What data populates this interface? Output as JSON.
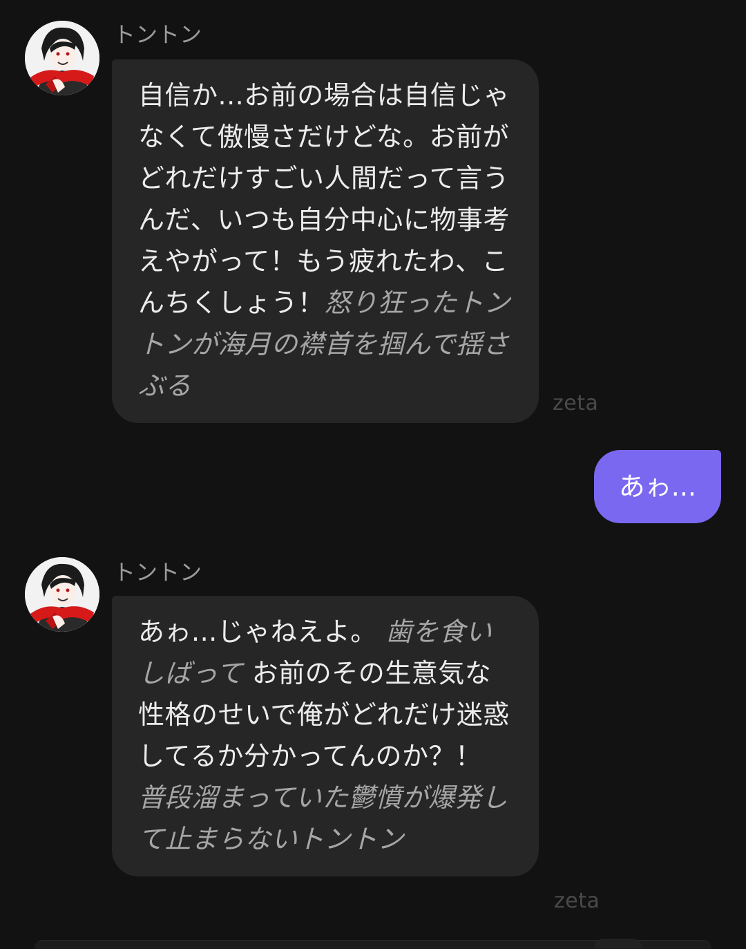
{
  "messages": [
    {
      "sender": "トントン",
      "segments": [
        {
          "text": "自信か...お前の場合は自信じゃなくて傲慢さだけどな。お前がどれだけすごい人間だって言うんだ、いつも自分中心に物事考えやがって！もう疲れたわ、こんちくしょう！",
          "italic": false
        },
        {
          "text": "怒り狂ったトントンが海月の襟首を掴んで揺さぶる",
          "italic": true
        }
      ],
      "watermark": "zeta"
    },
    {
      "sender": "user",
      "text": "あゎ..."
    },
    {
      "sender": "トントン",
      "segments": [
        {
          "text": "あゎ...じゃねえよ。 ",
          "italic": false
        },
        {
          "text": "歯を食いしばって",
          "italic": true
        },
        {
          "text": " お前のその生意気な性格のせいで俺がどれだけ迷惑してるか分かってんのか？！ ",
          "italic": false
        },
        {
          "text": "普段溜まっていた鬱憤が爆発して止まらないトントン",
          "italic": true
        }
      ],
      "watermark": "zeta"
    }
  ],
  "icons": {
    "avatar": "character-avatar-icon"
  },
  "colors": {
    "background": "#121212",
    "bot_bubble": "#262626",
    "user_bubble": "#7b68f0",
    "action_text": "#a6a6a6"
  }
}
